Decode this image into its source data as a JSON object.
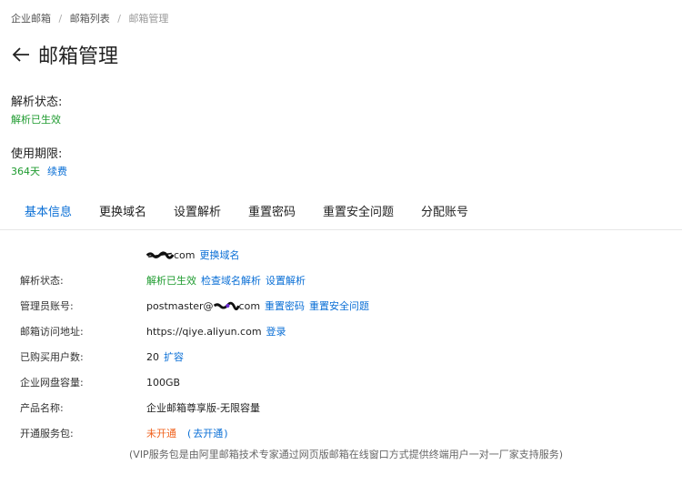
{
  "breadcrumb": [
    "企业邮箱",
    "邮箱列表",
    "邮箱管理"
  ],
  "page_title": "邮箱管理",
  "resolve_status": {
    "label": "解析状态:",
    "value": "解析已生效"
  },
  "usage_period": {
    "label": "使用期限:",
    "days": "364天",
    "renew": "续费"
  },
  "tabs": [
    "基本信息",
    "更换域名",
    "设置解析",
    "重置密码",
    "重置安全问题",
    "分配账号"
  ],
  "domain_row": {
    "suffix": "com",
    "change_link": "更换域名"
  },
  "rows": [
    {
      "label": "解析状态:",
      "value": "解析已生效",
      "link1": "检查域名解析",
      "link2": "设置解析"
    },
    {
      "label": "管理员账号:",
      "prefix": "postmaster@",
      "suffix": "com",
      "link1": "重置密码",
      "link2": "重置安全问题"
    },
    {
      "label": "邮箱访问地址:",
      "value": "https://qiye.aliyun.com",
      "link1": "登录"
    },
    {
      "label": "已购买用户数:",
      "value": "20",
      "link1": "扩容"
    },
    {
      "label": "企业网盘容量:",
      "value": "100GB"
    },
    {
      "label": "产品名称:",
      "value": "企业邮箱尊享版-无限容量"
    },
    {
      "label": "开通服务包:",
      "value": "未开通",
      "link_open": "(",
      "link1": "去开通",
      "link_close": ")"
    }
  ],
  "note": "(VIP服务包是由阿里邮箱技术专家通过网页版邮箱在线窗口方式提供终端用户一对一厂家支持服务)",
  "colors": {
    "accent": "#0a6fd6",
    "success": "#1e9b2f",
    "warning": "#f0621d"
  }
}
